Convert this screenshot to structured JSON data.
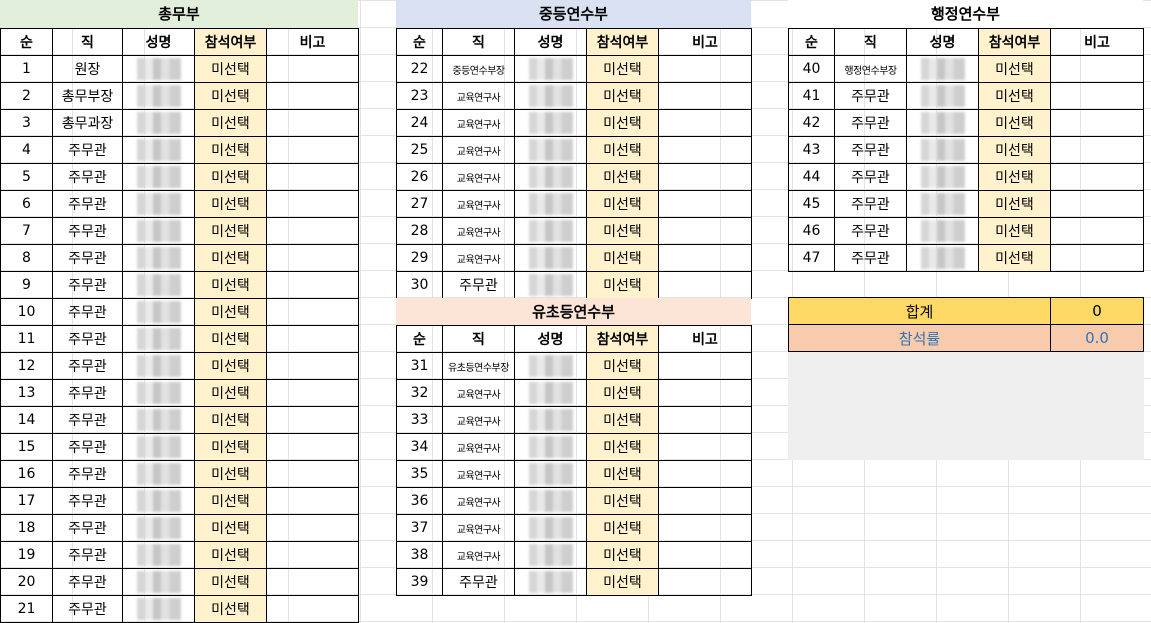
{
  "headers": {
    "no": "순",
    "position": "직",
    "name": "성명",
    "attendance": "참석여부",
    "note": "비고"
  },
  "attendance_value": "미선택",
  "dept_general": {
    "title": "총무부",
    "rows": [
      {
        "no": "1",
        "position": "원장"
      },
      {
        "no": "2",
        "position": "총무부장"
      },
      {
        "no": "3",
        "position": "총무과장"
      },
      {
        "no": "4",
        "position": "주무관"
      },
      {
        "no": "5",
        "position": "주무관"
      },
      {
        "no": "6",
        "position": "주무관"
      },
      {
        "no": "7",
        "position": "주무관"
      },
      {
        "no": "8",
        "position": "주무관"
      },
      {
        "no": "9",
        "position": "주무관"
      },
      {
        "no": "10",
        "position": "주무관"
      },
      {
        "no": "11",
        "position": "주무관"
      },
      {
        "no": "12",
        "position": "주무관"
      },
      {
        "no": "13",
        "position": "주무관"
      },
      {
        "no": "14",
        "position": "주무관"
      },
      {
        "no": "15",
        "position": "주무관"
      },
      {
        "no": "16",
        "position": "주무관"
      },
      {
        "no": "17",
        "position": "주무관"
      },
      {
        "no": "18",
        "position": "주무관"
      },
      {
        "no": "19",
        "position": "주무관"
      },
      {
        "no": "20",
        "position": "주무관"
      },
      {
        "no": "21",
        "position": "주무관"
      }
    ]
  },
  "dept_secondary": {
    "title": "중등연수부",
    "rows": [
      {
        "no": "22",
        "position": "중등연수부장"
      },
      {
        "no": "23",
        "position": "교육연구사"
      },
      {
        "no": "24",
        "position": "교육연구사"
      },
      {
        "no": "25",
        "position": "교육연구사"
      },
      {
        "no": "26",
        "position": "교육연구사"
      },
      {
        "no": "27",
        "position": "교육연구사"
      },
      {
        "no": "28",
        "position": "교육연구사"
      },
      {
        "no": "29",
        "position": "교육연구사"
      },
      {
        "no": "30",
        "position": "주무관"
      }
    ]
  },
  "dept_elementary": {
    "title": "유초등연수부",
    "rows": [
      {
        "no": "31",
        "position": "유초등연수부장"
      },
      {
        "no": "32",
        "position": "교육연구사"
      },
      {
        "no": "33",
        "position": "교육연구사"
      },
      {
        "no": "34",
        "position": "교육연구사"
      },
      {
        "no": "35",
        "position": "교육연구사"
      },
      {
        "no": "36",
        "position": "교육연구사"
      },
      {
        "no": "37",
        "position": "교육연구사"
      },
      {
        "no": "38",
        "position": "교육연구사"
      },
      {
        "no": "39",
        "position": "주무관"
      }
    ]
  },
  "dept_admin": {
    "title": "행정연수부",
    "rows": [
      {
        "no": "40",
        "position": "행정연수부장"
      },
      {
        "no": "41",
        "position": "주무관"
      },
      {
        "no": "42",
        "position": "주무관"
      },
      {
        "no": "43",
        "position": "주무관"
      },
      {
        "no": "44",
        "position": "주무관"
      },
      {
        "no": "45",
        "position": "주무관"
      },
      {
        "no": "46",
        "position": "주무관"
      },
      {
        "no": "47",
        "position": "주무관"
      }
    ]
  },
  "summary": {
    "total_label": "합계",
    "total_value": "0",
    "rate_label": "참석률",
    "rate_value": "0.0"
  },
  "colors": {
    "general_header": "#e2efda",
    "secondary_header": "#d9e1f2",
    "elementary_header": "#fce4d6",
    "admin_header": "#ffffff",
    "attendance_fill": "#fff2cc",
    "total_fill": "#ffd966",
    "rate_fill": "#f8cbad",
    "rate_text": "#2f75b5"
  }
}
